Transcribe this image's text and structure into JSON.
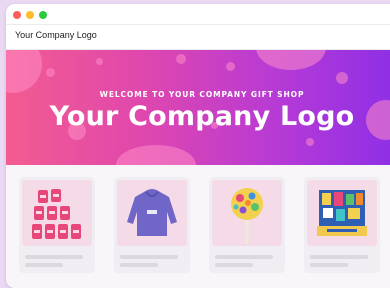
{
  "window": {
    "controls": [
      "close",
      "minimize",
      "maximize"
    ]
  },
  "navbar": {
    "logo_text": "Your Company Logo"
  },
  "hero": {
    "subtitle": "WELCOME TO YOUR COMPANY GIFT SHOP",
    "title": "Your Company Logo",
    "gradient": [
      "#f35c8f",
      "#df47ae",
      "#b53ad6",
      "#8d2fe6"
    ]
  },
  "products": [
    {
      "image": "candy-bags-image"
    },
    {
      "image": "hoodie-image"
    },
    {
      "image": "lollipop-image"
    },
    {
      "image": "gift-box-image"
    }
  ],
  "colors": {
    "page_bg": "#ead9f3",
    "close": "#fc5f57",
    "minimize": "#febc2e",
    "maximize": "#2ac940"
  }
}
